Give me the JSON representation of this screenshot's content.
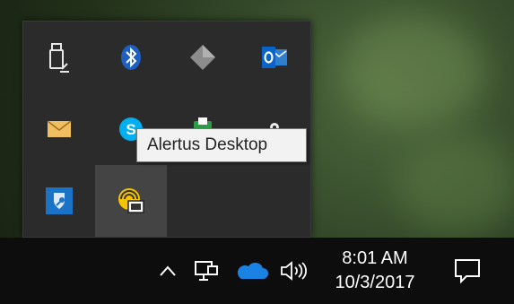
{
  "tooltip": {
    "text": "Alertus Desktop"
  },
  "tray_icons": [
    {
      "name": "usb-eject-icon"
    },
    {
      "name": "bluetooth-icon"
    },
    {
      "name": "diamond-app-icon"
    },
    {
      "name": "outlook-icon"
    },
    {
      "name": "mail-icon"
    },
    {
      "name": "skype-icon"
    },
    {
      "name": "green-app-icon"
    },
    {
      "name": "white-dot-app-icon"
    },
    {
      "name": "shield-key-icon"
    },
    {
      "name": "alertus-desktop-icon",
      "hovered": true
    }
  ],
  "taskbar": {
    "time": "8:01 AM",
    "date": "10/3/2017",
    "icons": [
      "show-hidden-icons-chevron-icon",
      "network-icon",
      "onedrive-icon",
      "volume-icon",
      "action-center-icon"
    ]
  },
  "colors": {
    "taskbar": "#0d0d0d",
    "tray_panel": "#2b2b2b",
    "hover_cell": "#444444",
    "accent_blue": "#0078d7",
    "tooltip_bg": "#f2f2f2"
  }
}
